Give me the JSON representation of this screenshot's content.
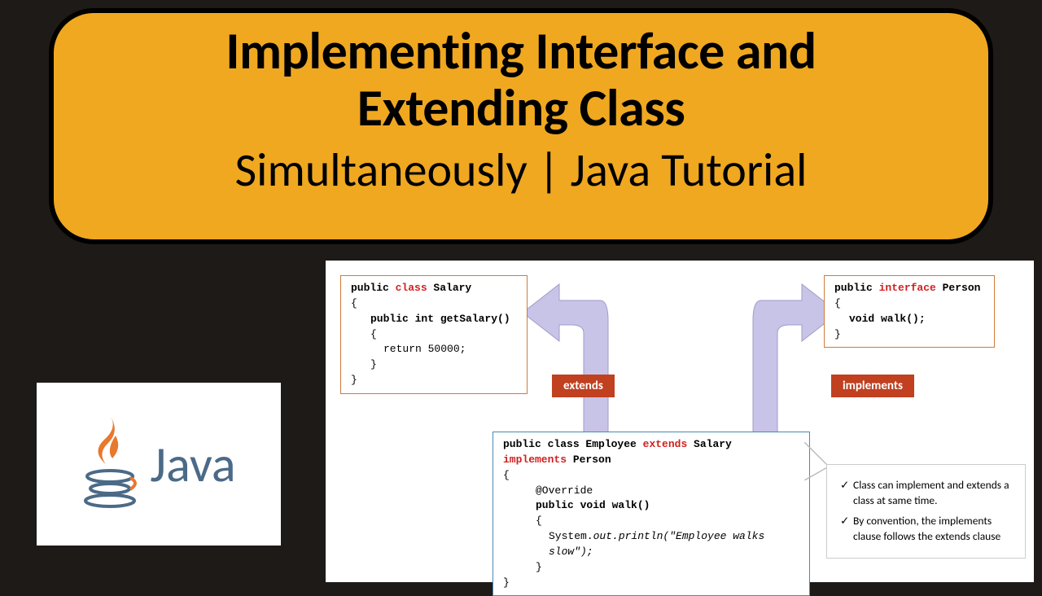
{
  "title": {
    "line1a": "Implementing Interface and",
    "line1b": "Extending Class",
    "line2": "Simultaneously | Java Tutorial"
  },
  "javaLogo": {
    "text": "Java"
  },
  "diagram": {
    "salary": {
      "l1a": "public ",
      "l1b": "class",
      "l1c": " Salary",
      "l2": "{",
      "l3": "public int getSalary()",
      "l4": "{",
      "l5": "return 50000;",
      "l6": "}",
      "l7": "}"
    },
    "person": {
      "l1a": "public ",
      "l1b": "interface",
      "l1c": " Person",
      "l2": "{",
      "l3": "void walk();",
      "l4": "}"
    },
    "employee": {
      "l1a": "public class Employee ",
      "l1b": "extends",
      "l1c": " Salary ",
      "l1d": "implements",
      "l1e": " Person",
      "l2": "{",
      "l3": "@Override",
      "l4": "public void walk()",
      "l5": "{",
      "l6a": "System.",
      "l6b": "out.println(\"Employee walks slow\");",
      "l7": "}",
      "l8": "}"
    },
    "tags": {
      "extends": "extends",
      "implements": "implements"
    },
    "notes": {
      "n1": "Class can implement and extends a class at same time.",
      "n2": "By convention, the implements clause follows the extends clause"
    }
  }
}
